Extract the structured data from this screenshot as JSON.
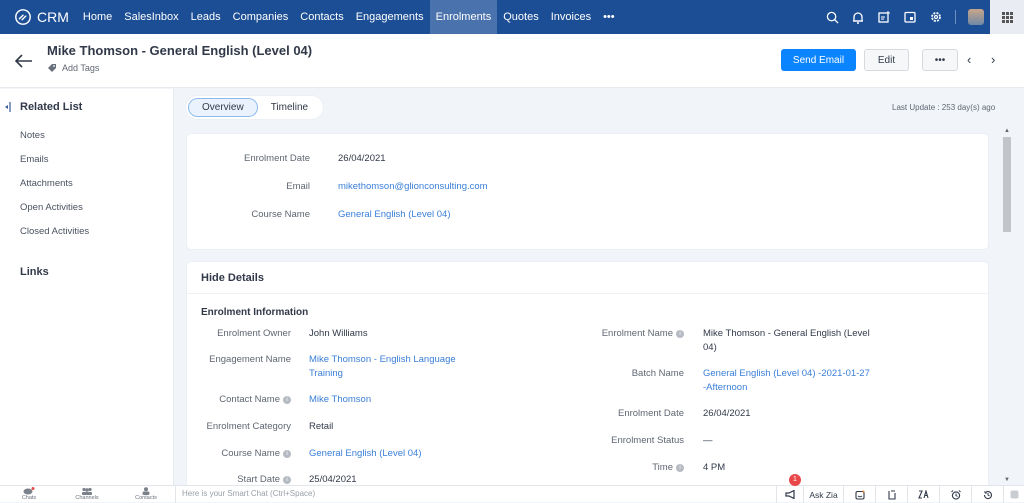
{
  "topbar": {
    "logo_text": "CRM",
    "nav_items": [
      "Home",
      "SalesInbox",
      "Leads",
      "Companies",
      "Contacts",
      "Engagements",
      "Enrolments",
      "Quotes",
      "Invoices"
    ],
    "active_nav": "Enrolments",
    "more_label": "•••",
    "icons": [
      "search-icon",
      "bell-icon",
      "add-note-icon",
      "calendar-icon",
      "gear-icon"
    ]
  },
  "header": {
    "title": "Mike Thomson - General English (Level 04)",
    "add_tags": "Add Tags",
    "send_email": "Send Email",
    "edit": "Edit",
    "more": "•••",
    "prev": "‹",
    "next": "›"
  },
  "sidebar": {
    "heading": "Related List",
    "items": [
      "Notes",
      "Emails",
      "Attachments",
      "Open Activities",
      "Closed Activities"
    ],
    "links": "Links"
  },
  "tabs": {
    "overview": "Overview",
    "timeline": "Timeline"
  },
  "last_update": "Last Update : 253 day(s) ago",
  "summary": [
    {
      "label": "Enrolment Date",
      "value": "26/04/2021",
      "link": false
    },
    {
      "label": "Email",
      "value": "mikethomson@glionconsulting.com",
      "link": true
    },
    {
      "label": "Course Name",
      "value": "General English (Level 04)",
      "link": true
    }
  ],
  "details": {
    "hide_label": "Hide Details",
    "section_title": "Enrolment Information",
    "left": [
      {
        "label": "Enrolment Owner",
        "value": "John Williams",
        "link": false,
        "info": false
      },
      {
        "label": "Engagement Name",
        "value": "Mike Thomson - English Language Training",
        "link": true,
        "info": false
      },
      {
        "label": "Contact Name",
        "value": "Mike Thomson",
        "link": true,
        "info": true
      },
      {
        "label": "Enrolment Category",
        "value": "Retail",
        "link": false,
        "info": false
      },
      {
        "label": "Course Name",
        "value": "General English (Level 04)",
        "link": true,
        "info": true
      },
      {
        "label": "Start Date",
        "value": "25/04/2021",
        "link": false,
        "info": true
      }
    ],
    "right": [
      {
        "label": "Enrolment Name",
        "value": "Mike Thomson - General English (Level 04)",
        "link": false,
        "info": true
      },
      {
        "label": "Batch Name",
        "value": "General English (Level 04) -2021-01-27 -Afternoon",
        "link": true,
        "info": false
      },
      {
        "label": "Enrolment Date",
        "value": "26/04/2021",
        "link": false,
        "info": false
      },
      {
        "label": "Enrolment Status",
        "value": "—",
        "link": false,
        "info": false
      },
      {
        "label": "Time",
        "value": "4 PM",
        "link": false,
        "info": true
      }
    ]
  },
  "bottombar": {
    "chats": "Chats",
    "channels": "Channels",
    "contacts": "Contacts",
    "chat_placeholder": "Here is your Smart Chat (Ctrl+Space)",
    "ask_zia": "Ask Zia",
    "notification_count": "1"
  }
}
